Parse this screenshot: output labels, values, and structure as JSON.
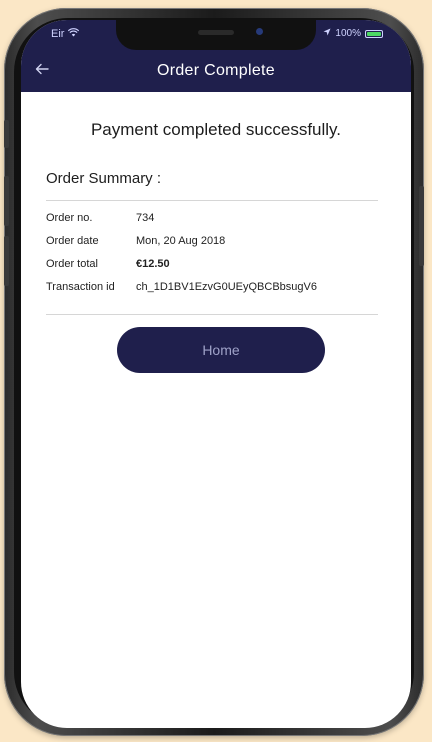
{
  "status_bar": {
    "carrier": "Eir",
    "battery": "100%"
  },
  "navbar": {
    "back_icon": "arrow-left-icon",
    "title": "Order Complete"
  },
  "main": {
    "success_message": "Payment completed successfully.",
    "summary_heading": "Order Summary :",
    "details": [
      {
        "label": "Order no.",
        "value": "734"
      },
      {
        "label": "Order date",
        "value": "Mon, 20 Aug 2018"
      },
      {
        "label": "Order total",
        "value": "€12.50"
      },
      {
        "label": "Transaction id",
        "value": "ch_1D1BV1EzvG0UEyQBCBbsugV6"
      }
    ],
    "home_button": "Home"
  },
  "colors": {
    "background": "#fbe7c6",
    "navbar": "#1f1f4c",
    "button": "#1f1f4c",
    "button_text": "#9fa2c8"
  }
}
